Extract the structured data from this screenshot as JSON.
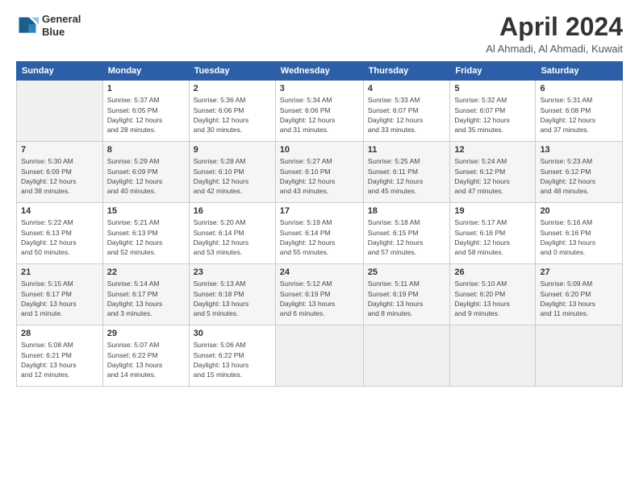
{
  "logo": {
    "line1": "General",
    "line2": "Blue"
  },
  "title": "April 2024",
  "subtitle": "Al Ahmadi, Al Ahmadi, Kuwait",
  "days_of_week": [
    "Sunday",
    "Monday",
    "Tuesday",
    "Wednesday",
    "Thursday",
    "Friday",
    "Saturday"
  ],
  "weeks": [
    [
      {
        "day": "",
        "info": ""
      },
      {
        "day": "1",
        "info": "Sunrise: 5:37 AM\nSunset: 6:05 PM\nDaylight: 12 hours\nand 28 minutes."
      },
      {
        "day": "2",
        "info": "Sunrise: 5:36 AM\nSunset: 6:06 PM\nDaylight: 12 hours\nand 30 minutes."
      },
      {
        "day": "3",
        "info": "Sunrise: 5:34 AM\nSunset: 6:06 PM\nDaylight: 12 hours\nand 31 minutes."
      },
      {
        "day": "4",
        "info": "Sunrise: 5:33 AM\nSunset: 6:07 PM\nDaylight: 12 hours\nand 33 minutes."
      },
      {
        "day": "5",
        "info": "Sunrise: 5:32 AM\nSunset: 6:07 PM\nDaylight: 12 hours\nand 35 minutes."
      },
      {
        "day": "6",
        "info": "Sunrise: 5:31 AM\nSunset: 6:08 PM\nDaylight: 12 hours\nand 37 minutes."
      }
    ],
    [
      {
        "day": "7",
        "info": "Sunrise: 5:30 AM\nSunset: 6:09 PM\nDaylight: 12 hours\nand 38 minutes."
      },
      {
        "day": "8",
        "info": "Sunrise: 5:29 AM\nSunset: 6:09 PM\nDaylight: 12 hours\nand 40 minutes."
      },
      {
        "day": "9",
        "info": "Sunrise: 5:28 AM\nSunset: 6:10 PM\nDaylight: 12 hours\nand 42 minutes."
      },
      {
        "day": "10",
        "info": "Sunrise: 5:27 AM\nSunset: 6:10 PM\nDaylight: 12 hours\nand 43 minutes."
      },
      {
        "day": "11",
        "info": "Sunrise: 5:25 AM\nSunset: 6:11 PM\nDaylight: 12 hours\nand 45 minutes."
      },
      {
        "day": "12",
        "info": "Sunrise: 5:24 AM\nSunset: 6:12 PM\nDaylight: 12 hours\nand 47 minutes."
      },
      {
        "day": "13",
        "info": "Sunrise: 5:23 AM\nSunset: 6:12 PM\nDaylight: 12 hours\nand 48 minutes."
      }
    ],
    [
      {
        "day": "14",
        "info": "Sunrise: 5:22 AM\nSunset: 6:13 PM\nDaylight: 12 hours\nand 50 minutes."
      },
      {
        "day": "15",
        "info": "Sunrise: 5:21 AM\nSunset: 6:13 PM\nDaylight: 12 hours\nand 52 minutes."
      },
      {
        "day": "16",
        "info": "Sunrise: 5:20 AM\nSunset: 6:14 PM\nDaylight: 12 hours\nand 53 minutes."
      },
      {
        "day": "17",
        "info": "Sunrise: 5:19 AM\nSunset: 6:14 PM\nDaylight: 12 hours\nand 55 minutes."
      },
      {
        "day": "18",
        "info": "Sunrise: 5:18 AM\nSunset: 6:15 PM\nDaylight: 12 hours\nand 57 minutes."
      },
      {
        "day": "19",
        "info": "Sunrise: 5:17 AM\nSunset: 6:16 PM\nDaylight: 12 hours\nand 58 minutes."
      },
      {
        "day": "20",
        "info": "Sunrise: 5:16 AM\nSunset: 6:16 PM\nDaylight: 13 hours\nand 0 minutes."
      }
    ],
    [
      {
        "day": "21",
        "info": "Sunrise: 5:15 AM\nSunset: 6:17 PM\nDaylight: 13 hours\nand 1 minute."
      },
      {
        "day": "22",
        "info": "Sunrise: 5:14 AM\nSunset: 6:17 PM\nDaylight: 13 hours\nand 3 minutes."
      },
      {
        "day": "23",
        "info": "Sunrise: 5:13 AM\nSunset: 6:18 PM\nDaylight: 13 hours\nand 5 minutes."
      },
      {
        "day": "24",
        "info": "Sunrise: 5:12 AM\nSunset: 6:19 PM\nDaylight: 13 hours\nand 6 minutes."
      },
      {
        "day": "25",
        "info": "Sunrise: 5:11 AM\nSunset: 6:19 PM\nDaylight: 13 hours\nand 8 minutes."
      },
      {
        "day": "26",
        "info": "Sunrise: 5:10 AM\nSunset: 6:20 PM\nDaylight: 13 hours\nand 9 minutes."
      },
      {
        "day": "27",
        "info": "Sunrise: 5:09 AM\nSunset: 6:20 PM\nDaylight: 13 hours\nand 11 minutes."
      }
    ],
    [
      {
        "day": "28",
        "info": "Sunrise: 5:08 AM\nSunset: 6:21 PM\nDaylight: 13 hours\nand 12 minutes."
      },
      {
        "day": "29",
        "info": "Sunrise: 5:07 AM\nSunset: 6:22 PM\nDaylight: 13 hours\nand 14 minutes."
      },
      {
        "day": "30",
        "info": "Sunrise: 5:06 AM\nSunset: 6:22 PM\nDaylight: 13 hours\nand 15 minutes."
      },
      {
        "day": "",
        "info": ""
      },
      {
        "day": "",
        "info": ""
      },
      {
        "day": "",
        "info": ""
      },
      {
        "day": "",
        "info": ""
      }
    ]
  ]
}
